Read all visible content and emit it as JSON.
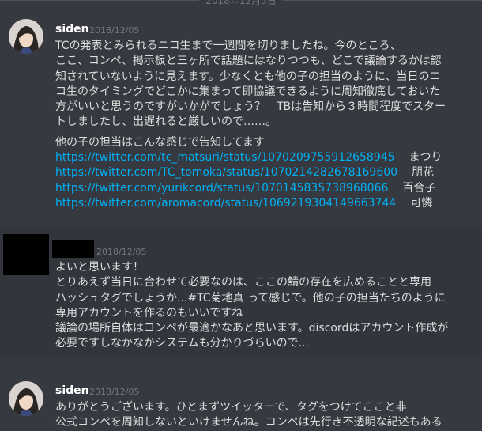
{
  "date_divider": "2018年12月5日",
  "messages": [
    {
      "author": "siden",
      "timestamp": "2018/12/05",
      "lines": [
        "TCの発表とみられるニコ生まで一週間を切りましたね。今のところ、",
        "ここ、コンペ、掲示板と三ヶ所で話題にはなりつつも、どこで議論するかは認",
        "知されていないように見えます。少なくとも他の子の担当のように、当日のニ",
        "コ生のタイミングでどこかに集まって即協議できるように周知徹底しておいた",
        "方がいいと思うのですがいかがでしょう？　TBは告知から３時間程度でスター",
        "トしましたし、出遅れると厳しいので……。"
      ],
      "intro": "他の子の担当はこんな感じで告知してます",
      "links": [
        {
          "url": "https://twitter.com/tc_matsuri/status/1070209755912658945",
          "name": "まつり"
        },
        {
          "url": "https://twitter.com/TC_tomoka/status/1070214282678169600",
          "name": "朋花"
        },
        {
          "url": "https://twitter.com/yurikcord/status/1070145835738968066",
          "name": "百合子"
        },
        {
          "url": "https://twitter.com/aromacord/status/1069219304149663744",
          "name": "可憐"
        }
      ]
    },
    {
      "author": "",
      "timestamp": "2018/12/05",
      "lines": [
        "よいと思います！",
        "とりあえず当日に合わせて必要なのは、ここの鯖の存在を広めることと専用",
        "ハッシュタグでしょうか...#TC菊地真 って感じで。他の子の担当たちのように",
        "専用アカウントを作るのもいいですね",
        "議論の場所自体はコンペが最適かなあと思います。discordはアカウント作成が",
        "必要ですしなかなかシステムも分かりづらいので..."
      ]
    },
    {
      "author": "siden",
      "timestamp": "2018/12/05",
      "lines": [
        "ありがとうございます。ひとまずツイッターで、タグをつけてここと非",
        "公式コンペを周知しないといけませんね。コンペは先行き不透明な記述もある"
      ]
    }
  ]
}
